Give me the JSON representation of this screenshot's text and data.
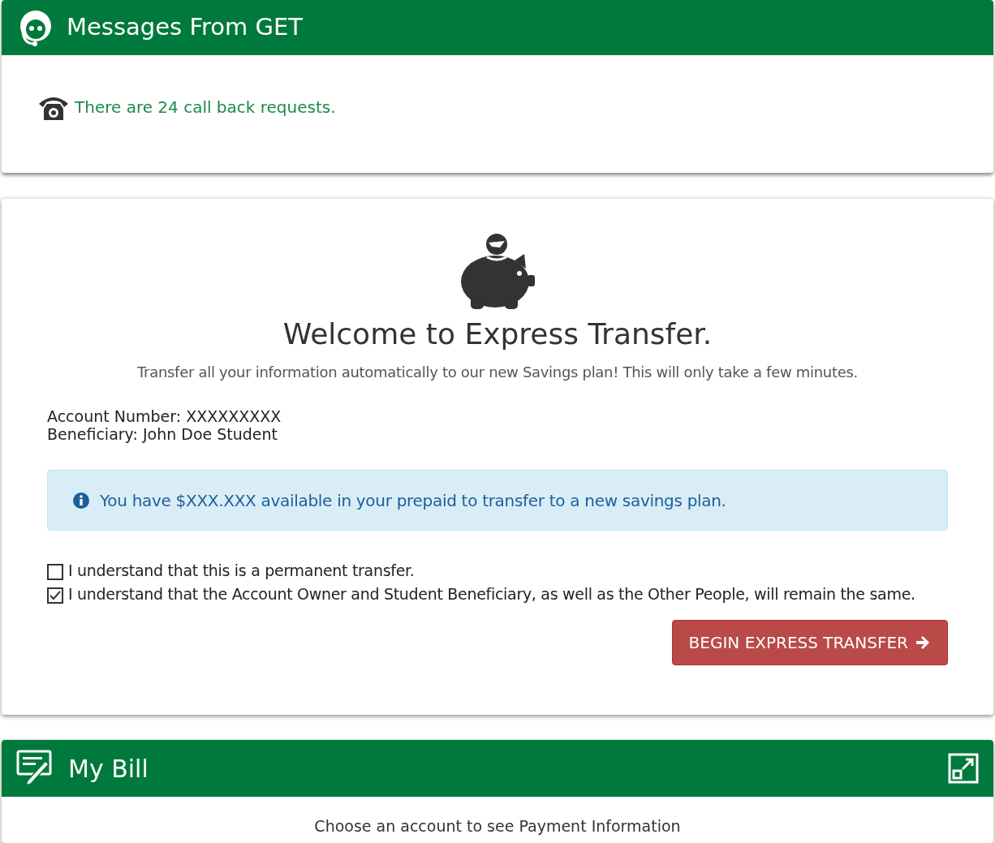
{
  "messages_panel": {
    "title": "Messages From GET",
    "notice": "There are 24 call back requests."
  },
  "express_transfer": {
    "heading": "Welcome to Express Transfer.",
    "intro": "Transfer all your information automatically to our new Savings plan! This will only take a few minutes.",
    "account_number": "Account Number: XXXXXXXXX",
    "beneficiary": "Beneficiary: John Doe Student",
    "info_alert": "You have $XXX.XXX available in your prepaid to transfer to a new savings plan.",
    "checkboxes": [
      {
        "label": "I understand that this is a permanent transfer.",
        "checked": false
      },
      {
        "label": "I understand that the Account Owner and Student Beneficiary, as well as the Other People, will remain the same.",
        "checked": true
      }
    ],
    "button": "BEGIN EXPRESS TRANSFER"
  },
  "bill_panel": {
    "title": "My Bill",
    "message": "Choose an account to see Payment Information"
  }
}
